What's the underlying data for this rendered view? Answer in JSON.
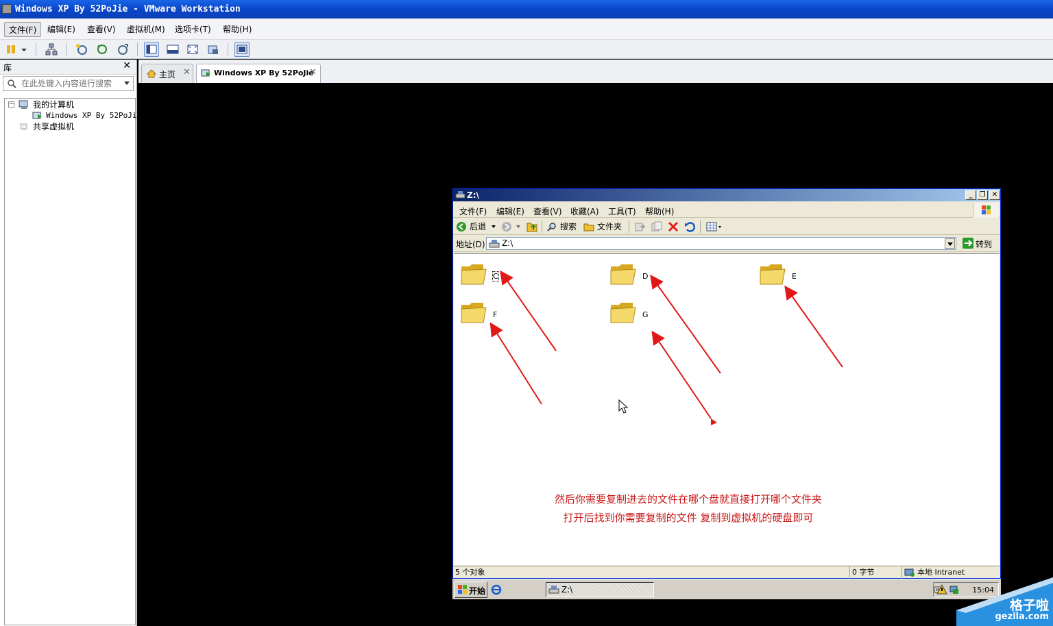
{
  "host": {
    "title": "Windows XP By 52PoJie - VMware Workstation",
    "menu": [
      "文件(F)",
      "编辑(E)",
      "查看(V)",
      "虚拟机(M)",
      "选项卡(T)",
      "帮助(H)"
    ]
  },
  "library": {
    "title": "库",
    "close": "✕",
    "search_placeholder": "在此处键入内容进行搜索",
    "tree": {
      "root": "我的计算机",
      "vm": "Windows XP By 52PoJie",
      "shared": "共享虚拟机",
      "collapse": "−"
    }
  },
  "tabs": [
    {
      "label": "主页",
      "close": "✕"
    },
    {
      "label": "Windows XP By 52PoJie",
      "close": "✕"
    }
  ],
  "guest": {
    "window_title": "Z:\\",
    "menu": [
      "文件(F)",
      "编辑(E)",
      "查看(V)",
      "收藏(A)",
      "工具(T)",
      "帮助(H)"
    ],
    "toolbar": {
      "back": "后退",
      "search": "搜索",
      "folders": "文件夹"
    },
    "address": {
      "label": "地址(D)",
      "value": "Z:\\",
      "go": "转到"
    },
    "folders": [
      "C",
      "D",
      "E",
      "F",
      "G"
    ],
    "annotation": [
      "然后你需要复制进去的文件在哪个盘就直接打开哪个文件夹",
      "打开后找到你需要复制的文件 复制到虚拟机的硬盘即可"
    ],
    "status": {
      "objects": "5 个对象",
      "size": "0 字节",
      "zone": "本地 Intranet"
    },
    "taskbar": {
      "start": "开始",
      "task": "Z:\\",
      "time": "15:04"
    }
  },
  "watermark": {
    "cn": "格子啦",
    "url": "gezila.com"
  }
}
